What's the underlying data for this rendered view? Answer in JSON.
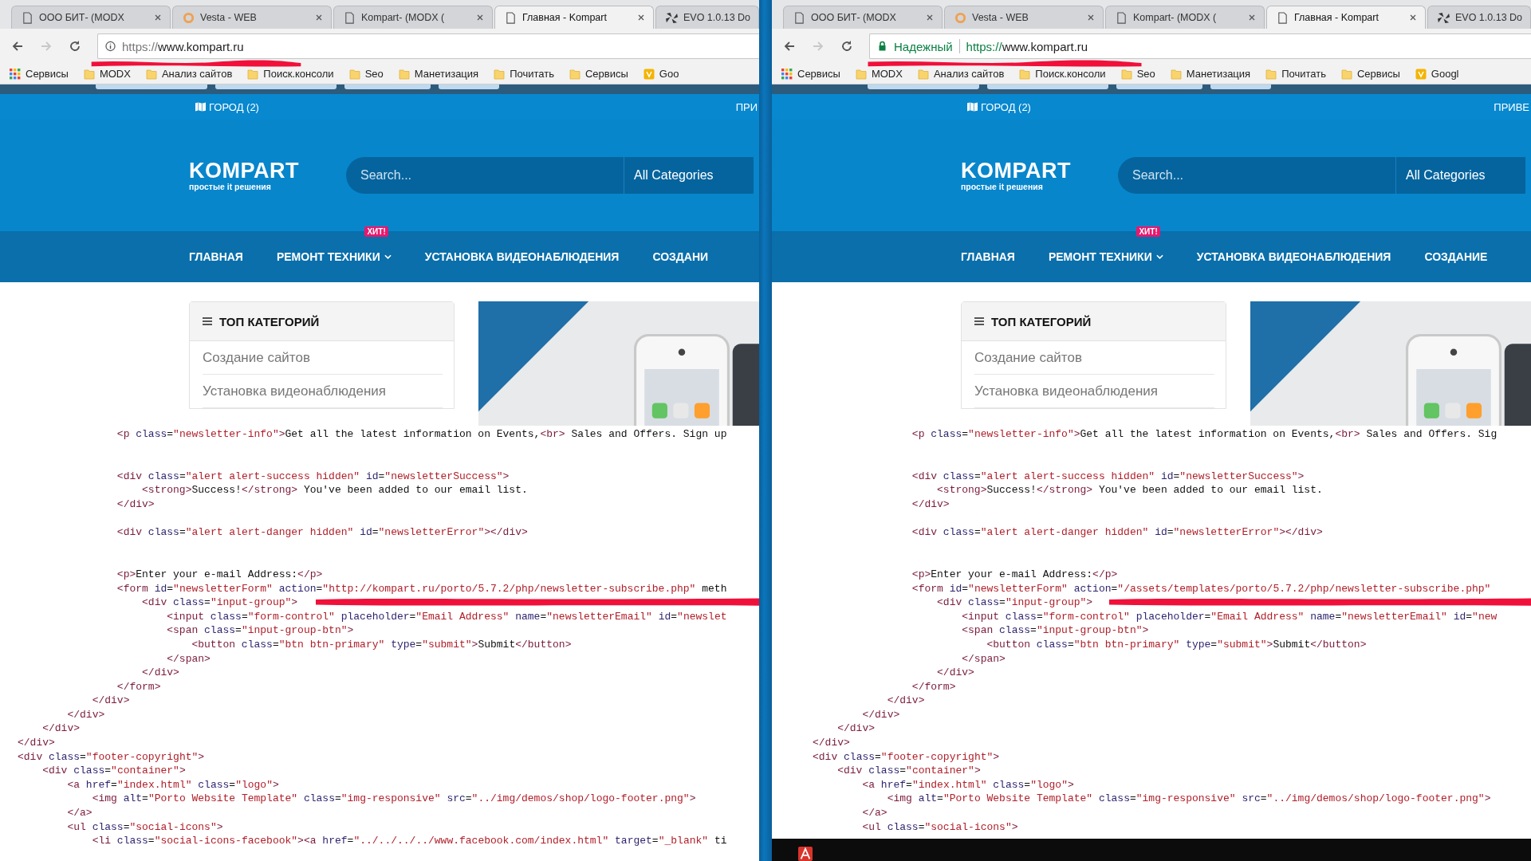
{
  "panes": [
    {
      "tabs": [
        {
          "title": "ООО БИТ- (MODX",
          "kind": "page",
          "selected": false
        },
        {
          "title": "Vesta - WEB",
          "kind": "vesta",
          "selected": false
        },
        {
          "title": "Kompart- (MODX (",
          "kind": "page",
          "selected": false
        },
        {
          "title": "Главная - Kompart",
          "kind": "page",
          "selected": true
        },
        {
          "title": "EVO 1.0.13 Do",
          "kind": "evo",
          "selected": false
        }
      ],
      "address": {
        "secure": false,
        "scheme": "https://",
        "host": "www.kompart.ru"
      },
      "bookmarks": [
        {
          "label": "Сервисы",
          "kind": "apps"
        },
        {
          "label": "MODX",
          "kind": "folder"
        },
        {
          "label": "Анализ сайтов",
          "kind": "folder"
        },
        {
          "label": "Поиск.консоли",
          "kind": "folder"
        },
        {
          "label": "Seo",
          "kind": "folder"
        },
        {
          "label": "Манетизация",
          "kind": "folder"
        },
        {
          "label": "Почитать",
          "kind": "folder"
        },
        {
          "label": "Сервисы",
          "kind": "folder"
        },
        {
          "label": "Goo",
          "kind": "site"
        }
      ],
      "page": {
        "city": "ГОРОД (2)",
        "top_right": "ПРИ",
        "logo": {
          "name": "KOMPART",
          "tagline": "простые it решения"
        },
        "search": {
          "placeholder": "Search...",
          "category": "All Categories"
        },
        "nav": [
          {
            "label": "ГЛАВНАЯ",
            "dropdown": false
          },
          {
            "label": "РЕМОНТ ТЕХНИКИ",
            "dropdown": true,
            "badge": "ХИТ!"
          },
          {
            "label": "УСТАНОВКА ВИДЕОНАБЛЮДЕНИЯ",
            "dropdown": false
          },
          {
            "label": "СОЗДАНИ",
            "dropdown": false
          }
        ],
        "categories": {
          "title": "ТОП КАТЕГОРИЙ",
          "items": [
            "Создание сайтов",
            "Установка видеонаблюдения"
          ]
        }
      },
      "source": "                <p class=\"newsletter-info\">Get all the latest information on Events,<br> Sales and Offers. Sign up\n\n\n                <div class=\"alert alert-success hidden\" id=\"newsletterSuccess\">\n                    <strong>Success!</strong> You've been added to our email list.\n                </div>\n\n                <div class=\"alert alert-danger hidden\" id=\"newsletterError\"></div>\n\n\n                <p>Enter your e-mail Address:</p>\n                <form id=\"newsletterForm\" action=\"http://kompart.ru/porto/5.7.2/php/newsletter-subscribe.php\" meth\n                    <div class=\"input-group\">\n                        <input class=\"form-control\" placeholder=\"Email Address\" name=\"newsletterEmail\" id=\"newslet\n                        <span class=\"input-group-btn\">\n                            <button class=\"btn btn-primary\" type=\"submit\">Submit</button>\n                        </span>\n                    </div>\n                </form>\n            </div>\n        </div>\n    </div>\n</div>\n<div class=\"footer-copyright\">\n    <div class=\"container\">\n        <a href=\"index.html\" class=\"logo\">\n            <img alt=\"Porto Website Template\" class=\"img-responsive\" src=\"../img/demos/shop/logo-footer.png\">\n        </a>\n        <ul class=\"social-icons\">\n            <li class=\"social-icons-facebook\"><a href=\"../../../../www.facebook.com/index.html\" target=\"_blank\" ti",
      "taskbar": false
    },
    {
      "tabs": [
        {
          "title": "ООО БИТ- (MODX",
          "kind": "page",
          "selected": false
        },
        {
          "title": "Vesta - WEB",
          "kind": "vesta",
          "selected": false
        },
        {
          "title": "Kompart- (MODX (",
          "kind": "page",
          "selected": false
        },
        {
          "title": "Главная - Kompart",
          "kind": "page",
          "selected": true
        },
        {
          "title": "EVO 1.0.13 Do",
          "kind": "evo",
          "selected": false
        }
      ],
      "address": {
        "secure": true,
        "security_label": "Надежный",
        "scheme": "https://",
        "host": "www.kompart.ru"
      },
      "bookmarks": [
        {
          "label": "Сервисы",
          "kind": "apps"
        },
        {
          "label": "MODX",
          "kind": "folder"
        },
        {
          "label": "Анализ сайтов",
          "kind": "folder"
        },
        {
          "label": "Поиск.консоли",
          "kind": "folder"
        },
        {
          "label": "Seo",
          "kind": "folder"
        },
        {
          "label": "Манетизация",
          "kind": "folder"
        },
        {
          "label": "Почитать",
          "kind": "folder"
        },
        {
          "label": "Сервисы",
          "kind": "folder"
        },
        {
          "label": "Googl",
          "kind": "site"
        }
      ],
      "page": {
        "city": "ГОРОД (2)",
        "top_right": "ПРИВЕ",
        "logo": {
          "name": "KOMPART",
          "tagline": "простые it решения"
        },
        "search": {
          "placeholder": "Search...",
          "category": "All Categories"
        },
        "nav": [
          {
            "label": "ГЛАВНАЯ",
            "dropdown": false
          },
          {
            "label": "РЕМОНТ ТЕХНИКИ",
            "dropdown": true,
            "badge": "ХИТ!"
          },
          {
            "label": "УСТАНОВКА ВИДЕОНАБЛЮДЕНИЯ",
            "dropdown": false
          },
          {
            "label": "СОЗДАНИЕ",
            "dropdown": false
          }
        ],
        "categories": {
          "title": "ТОП КАТЕГОРИЙ",
          "items": [
            "Создание сайтов",
            "Установка видеонаблюдения"
          ]
        }
      },
      "source": "                <p class=\"newsletter-info\">Get all the latest information on Events,<br> Sales and Offers. Sig\n\n\n                <div class=\"alert alert-success hidden\" id=\"newsletterSuccess\">\n                    <strong>Success!</strong> You've been added to our email list.\n                </div>\n\n                <div class=\"alert alert-danger hidden\" id=\"newsletterError\"></div>\n\n\n                <p>Enter your e-mail Address:</p>\n                <form id=\"newsletterForm\" action=\"/assets/templates/porto/5.7.2/php/newsletter-subscribe.php\"\n                    <div class=\"input-group\">\n                        <input class=\"form-control\" placeholder=\"Email Address\" name=\"newsletterEmail\" id=\"new\n                        <span class=\"input-group-btn\">\n                            <button class=\"btn btn-primary\" type=\"submit\">Submit</button>\n                        </span>\n                    </div>\n                </form>\n            </div>\n        </div>\n    </div>\n</div>\n<div class=\"footer-copyright\">\n    <div class=\"container\">\n        <a href=\"index.html\" class=\"logo\">\n            <img alt=\"Porto Website Template\" class=\"img-responsive\" src=\"../img/demos/shop/logo-footer.png\">\n        </a>\n        <ul class=\"social-icons\">",
      "taskbar": true
    }
  ]
}
